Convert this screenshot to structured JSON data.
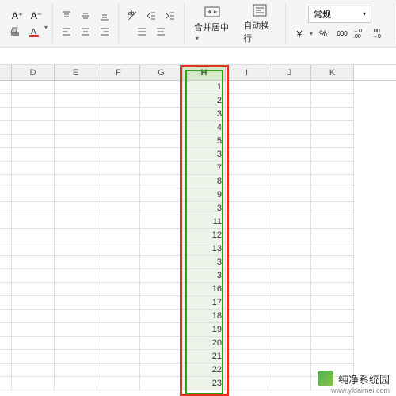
{
  "ribbon": {
    "font_group": {
      "increase_font": "A⁺",
      "decrease_font": "A⁻"
    },
    "merge_label": "合并居中",
    "wrap_label": "自动换行",
    "number_format": "常规",
    "currency": "￥",
    "percent": "%",
    "comma": "000",
    "decimal_inc": "←0 .00",
    "decimal_dec": ".00 →0"
  },
  "columns": [
    "D",
    "E",
    "F",
    "G",
    "H",
    "I",
    "J",
    "K"
  ],
  "selected_column": "H",
  "cells_H": [
    "1",
    "2",
    "3",
    "4",
    "5",
    "3",
    "7",
    "8",
    "9",
    "3",
    "11",
    "12",
    "13",
    "3",
    "3",
    "16",
    "17",
    "18",
    "19",
    "20",
    "21",
    "22",
    "23"
  ],
  "watermark": {
    "title": "纯净系统园",
    "url": "www.yidaimei.com"
  }
}
